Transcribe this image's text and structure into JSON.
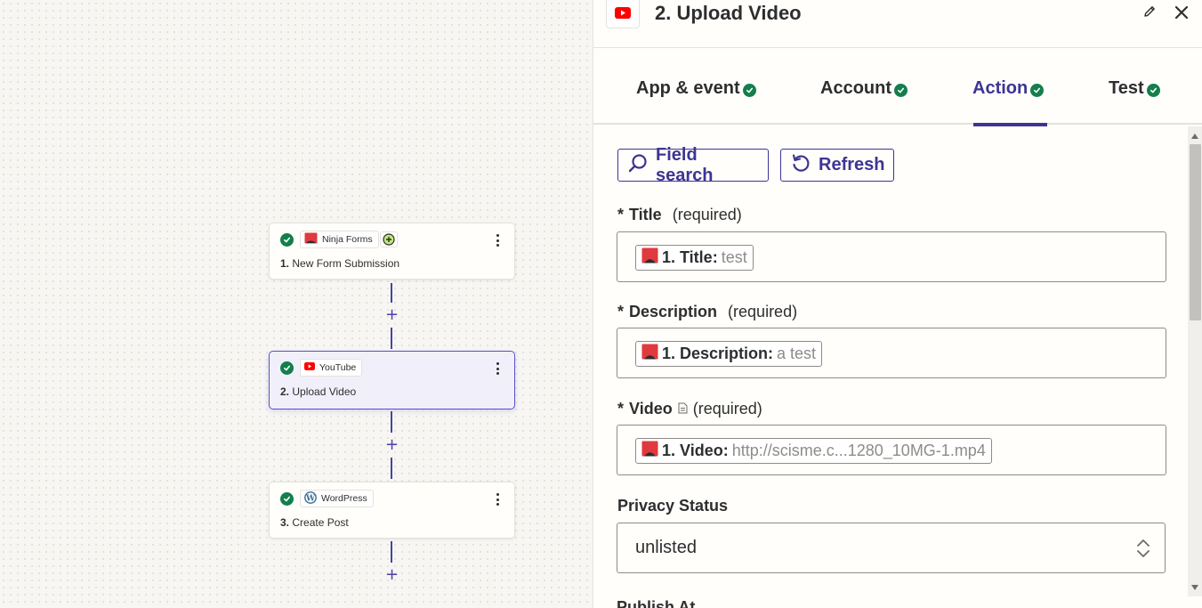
{
  "canvas": {
    "steps": [
      {
        "app": "Ninja Forms",
        "number": "1.",
        "title": "New Form Submission",
        "selected": false
      },
      {
        "app": "YouTube",
        "number": "2.",
        "title": "Upload Video",
        "selected": true
      },
      {
        "app": "WordPress",
        "number": "3.",
        "title": "Create Post",
        "selected": false
      }
    ],
    "plus": "+"
  },
  "panel": {
    "title": "2. Upload Video",
    "tabs": [
      {
        "label": "App & event",
        "active": false
      },
      {
        "label": "Account",
        "active": false
      },
      {
        "label": "Action",
        "active": true
      },
      {
        "label": "Test",
        "active": false
      }
    ],
    "buttons": {
      "field_search": "Field search",
      "refresh": "Refresh"
    },
    "fields": [
      {
        "label": "Title",
        "required_mark": "*",
        "required_text": "(required)",
        "pill_key": "1. Title:",
        "pill_value": "test"
      },
      {
        "label": "Description",
        "required_mark": "*",
        "required_text": "(required)",
        "pill_key": "1. Description:",
        "pill_value": "a test"
      },
      {
        "label": "Video",
        "required_mark": "*",
        "required_text": "(required)",
        "pill_key": "1. Video:",
        "pill_value": "http://scisme.c...1280_10MG-1.mp4"
      }
    ],
    "privacy": {
      "label": "Privacy Status",
      "value": "unlisted"
    },
    "cutoff_label": "Publish At"
  },
  "colors": {
    "accent": "#3d3593",
    "success": "#137f4d",
    "youtube_red": "#ff0000",
    "ninja_red": "#e0393e"
  }
}
